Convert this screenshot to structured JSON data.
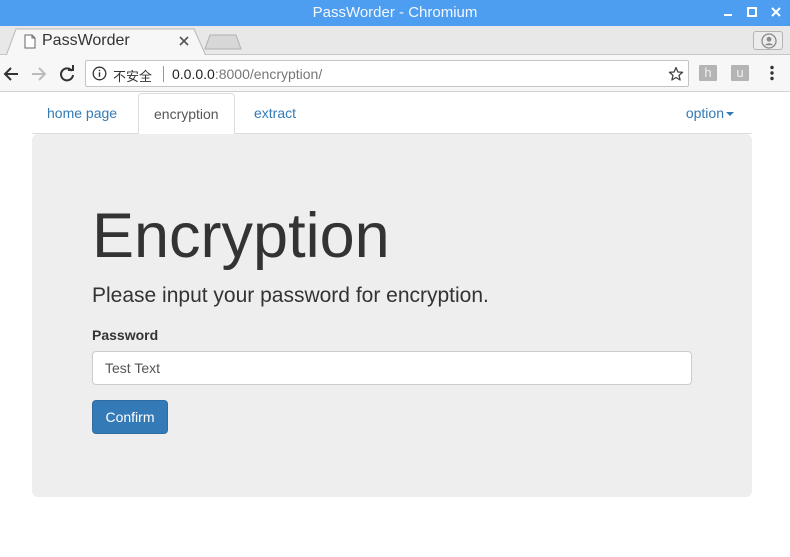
{
  "window": {
    "title": "PassWorder - Chromium"
  },
  "tab": {
    "title": "PassWorder"
  },
  "omnibox": {
    "security_label": "不安全",
    "url_host": "0.0.0.0",
    "url_rest": ":8000/encryption/"
  },
  "extensions": [
    {
      "label": "h"
    },
    {
      "label": "u"
    }
  ],
  "nav": {
    "items": [
      {
        "label": "home page"
      },
      {
        "label": "encryption"
      },
      {
        "label": "extract"
      }
    ],
    "option_label": "option"
  },
  "main": {
    "heading": "Encryption",
    "lead": "Please input your password for encryption.",
    "password_label": "Password",
    "password_value": "Test Text",
    "confirm_label": "Confirm"
  },
  "colors": {
    "titlebar": "#4d9ef0",
    "link": "#337ab7",
    "jumbotron": "#eeeeee",
    "button": "#337ab7"
  },
  "icons": [
    "document-icon",
    "close-icon",
    "back-icon",
    "forward-icon",
    "reload-icon",
    "info-icon",
    "star-icon",
    "menu-icon",
    "profile-icon",
    "minimize-icon",
    "maximize-icon",
    "window-close-icon"
  ]
}
